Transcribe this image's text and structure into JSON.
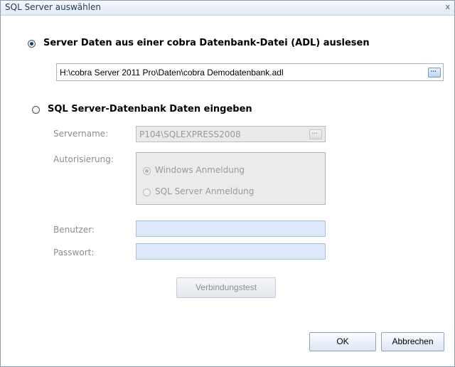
{
  "window": {
    "title": "SQL Server auswählen",
    "close_glyph": "x"
  },
  "option_adl": {
    "label": "Server Daten aus einer cobra Datenbank-Datei (ADL) auslesen",
    "selected": true,
    "path_value": "H:\\cobra Server 2011 Pro\\Daten\\cobra Demodatenbank.adl",
    "browse_glyph": "..."
  },
  "option_sql": {
    "label": "SQL Server-Datenbank Daten eingeben",
    "selected": false,
    "servername_label": "Servername:",
    "servername_value": "P104\\SQLEXPRESS2008",
    "browse_glyph": "...",
    "auth_label": "Autorisierung:",
    "auth_options": [
      "Windows Anmeldung",
      "SQL Server Anmeldung"
    ],
    "auth_selected": "Windows Anmeldung",
    "user_label": "Benutzer:",
    "user_value": "",
    "password_label": "Passwort:",
    "password_value": "",
    "test_button": "Verbindungstest"
  },
  "footer": {
    "ok": "OK",
    "cancel": "Abbrechen"
  }
}
